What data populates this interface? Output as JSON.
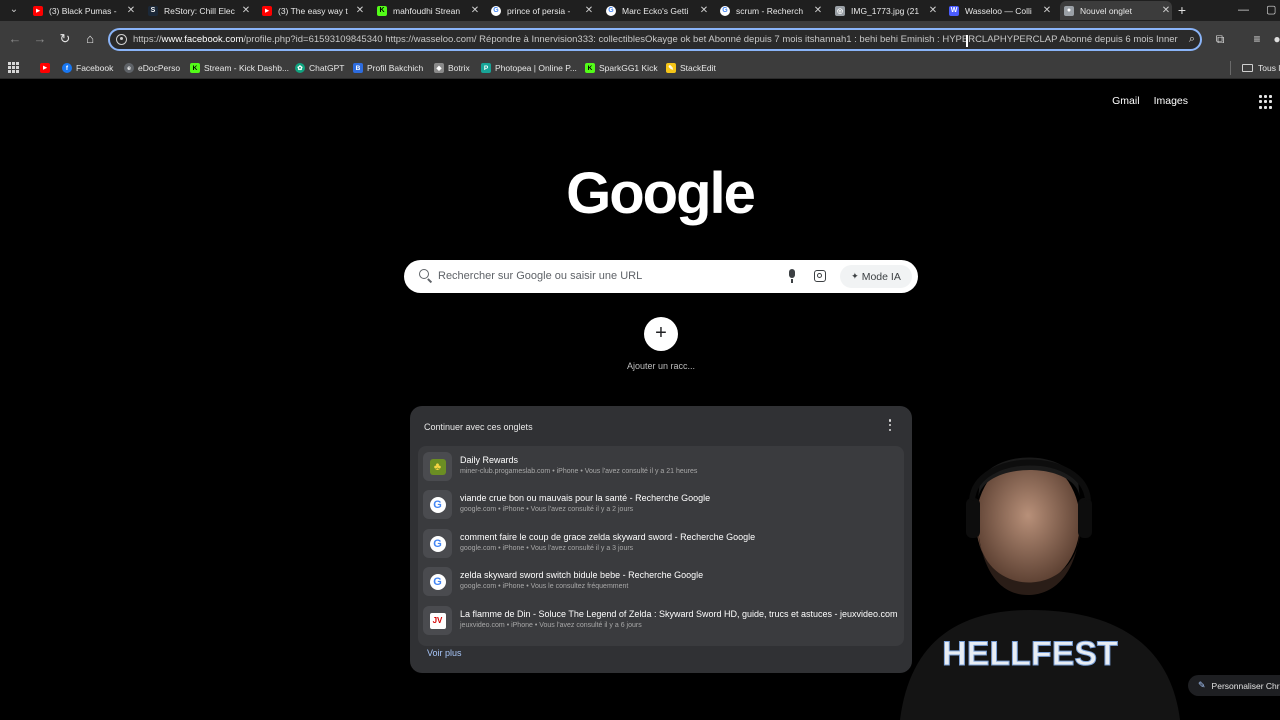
{
  "tabs": [
    {
      "title": "(3) Black Pumas -",
      "favicon": "youtube-icon",
      "color": "#ff0000"
    },
    {
      "title": "ReStory: Chill Elec",
      "favicon": "steam-icon",
      "color": "#1b2838"
    },
    {
      "title": "(3) The easy way t",
      "favicon": "youtube-icon",
      "color": "#ff0000"
    },
    {
      "title": "mahfoudhi Strean",
      "favicon": "kick-icon",
      "color": "#53fc18"
    },
    {
      "title": "prince of persia -",
      "favicon": "google-icon",
      "color": "#ffffff"
    },
    {
      "title": "Marc Ecko's Getti",
      "favicon": "google-icon",
      "color": "#ffffff"
    },
    {
      "title": "scrum - Recherch",
      "favicon": "google-icon",
      "color": "#ffffff"
    },
    {
      "title": "IMG_1773.jpg (21",
      "favicon": "globe-icon",
      "color": "#9aa0a6"
    },
    {
      "title": "Wasseloo — Colli",
      "favicon": "wasseloo-icon",
      "color": "#4a5cff"
    },
    {
      "title": "Nouvel onglet",
      "favicon": "chrome-icon",
      "color": "#9aa0a6",
      "active": true
    }
  ],
  "window_controls": {
    "minimize": "—",
    "maximize": "▢"
  },
  "address_bar": {
    "host_prefix": "https://",
    "host": "www.facebook.com",
    "rest": "/profile.php?id=61593109845340 https://wasseloo.com/ Répondre à Innervision333: collectiblesOkayge ok bet Abonné depuis 7 mois itshannah1 : behi behi Eminish : HYPERCLAPHYPERCLAP Abonné depuis 6 mois Inner"
  },
  "bookmarks": [
    {
      "label": "",
      "icon": "youtube-icon",
      "color": "#ff0000"
    },
    {
      "label": "Facebook",
      "icon": "facebook-icon",
      "color": "#1877f2"
    },
    {
      "label": "eDocPerso",
      "icon": "edocperso-icon",
      "color": "#5f6368"
    },
    {
      "label": "Stream - Kick Dashb...",
      "icon": "kick-icon",
      "color": "#53fc18"
    },
    {
      "label": "ChatGPT",
      "icon": "chatgpt-icon",
      "color": "#10a37f"
    },
    {
      "label": "Profil Bakchich",
      "icon": "bakchich-icon",
      "color": "#2d6cdf"
    },
    {
      "label": "Botrix",
      "icon": "botrix-icon",
      "color": "#8a8a8a"
    },
    {
      "label": "Photopea | Online P...",
      "icon": "photopea-icon",
      "color": "#18a497"
    },
    {
      "label": "SparkGG1 Kick",
      "icon": "kick-icon",
      "color": "#53fc18"
    },
    {
      "label": "StackEdit",
      "icon": "stackedit-icon",
      "color": "#f5c518"
    }
  ],
  "bookmarks_folder": "Tous les favoris",
  "ntp": {
    "links": {
      "gmail": "Gmail",
      "images": "Images"
    },
    "logo": "Google",
    "search_placeholder": "Rechercher sur Google ou saisir une URL",
    "mode_ia": "Mode IA",
    "add_shortcut_label": "Ajouter un racc..."
  },
  "continue_card": {
    "title": "Continuer avec ces onglets",
    "more_label": "Voir plus",
    "items": [
      {
        "title": "Daily Rewards",
        "sub": "miner-club.progameslab.com • iPhone • Vous l'avez consulté il y a 21 heures",
        "icon": "daily-rewards-icon"
      },
      {
        "title": "viande crue bon ou mauvais pour la santé - Recherche Google",
        "sub": "google.com • iPhone • Vous l'avez consulté il y a 2 jours",
        "icon": "google-icon"
      },
      {
        "title": "comment faire le coup de grace zelda skyward sword - Recherche Google",
        "sub": "google.com • iPhone • Vous l'avez consulté il y a 3 jours",
        "icon": "google-icon"
      },
      {
        "title": "zelda skyward sword switch bidule bebe - Recherche Google",
        "sub": "google.com • iPhone • Vous le consultez fréquemment",
        "icon": "google-icon"
      },
      {
        "title": "La flamme de Din - Soluce The Legend of Zelda : Skyward Sword HD, guide, trucs et astuces - jeuxvideo.com",
        "sub": "jeuxvideo.com • iPhone • Vous l'avez consulté il y a 6 jours",
        "icon": "jeuxvideo-icon"
      }
    ]
  },
  "customize_button": "Personnaliser Chrome",
  "webcam_shirt_text": "HELLFEST"
}
